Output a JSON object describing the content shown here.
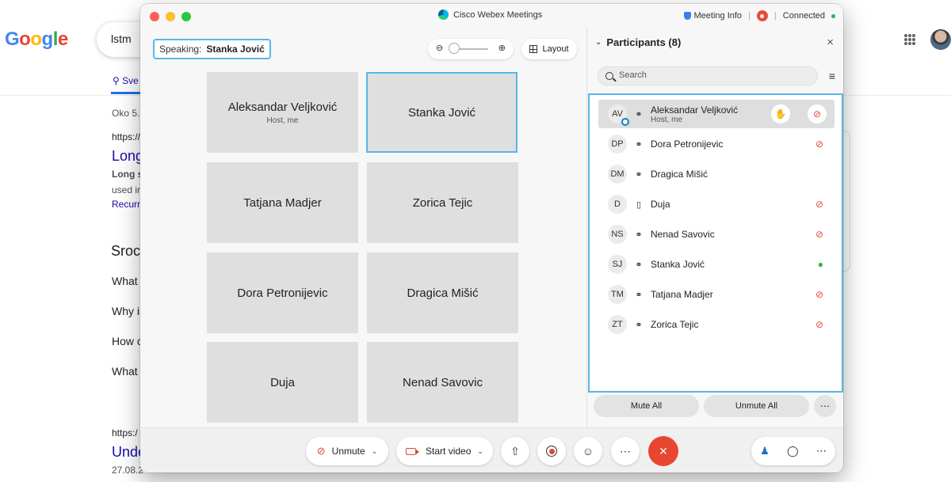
{
  "google": {
    "logo_letters": [
      "G",
      "o",
      "o",
      "g",
      "l",
      "e"
    ],
    "search_value": "lstm",
    "tab_label": "Sve",
    "stats": "Oko 5.",
    "result1_url": "https://",
    "result1_title": "Long",
    "result1_snippet1": "Long s",
    "result1_snippet2": "used ir",
    "result1_link": "Recurr",
    "section_heading": "Sroc",
    "questions": [
      "What",
      "Why is",
      "How c",
      "What"
    ],
    "result2_url": "https:/",
    "result2_title": "Unde",
    "result2_date": "27.08.2"
  },
  "window": {
    "title": "Cisco Webex Meetings",
    "meeting_info": "Meeting Info",
    "status": "Connected",
    "colors": {
      "close": "#fe5f57",
      "minimize": "#febc2e",
      "maximize": "#28c840",
      "accent": "#5bb5e8",
      "end_call": "#e8472f"
    }
  },
  "video": {
    "speaking_label": "Speaking:",
    "speaking_name": "Stanka Jović",
    "zoom_out_icon": "zoom-out-icon",
    "zoom_in_icon": "zoom-in-icon",
    "layout_label": "Layout",
    "tiles": [
      {
        "name": "Aleksandar Veljković",
        "sub": "Host, me"
      },
      {
        "name": "Stanka Jović",
        "sub": ""
      },
      {
        "name": "Tatjana Madjer",
        "sub": ""
      },
      {
        "name": "Zorica Tejic",
        "sub": ""
      },
      {
        "name": "Dora Petronijevic",
        "sub": ""
      },
      {
        "name": "Dragica Mišić",
        "sub": ""
      },
      {
        "name": "Duja",
        "sub": ""
      },
      {
        "name": "Nenad Savovic",
        "sub": ""
      }
    ]
  },
  "controls": {
    "unmute_label": "Unmute",
    "start_video_label": "Start video"
  },
  "participants": {
    "title": "Participants (8)",
    "search_placeholder": "Search",
    "mute_all": "Mute All",
    "unmute_all": "Unmute All",
    "list": [
      {
        "initials": "AV",
        "name": "Aleksandar Veljković",
        "sub": "Host, me",
        "device": "headset",
        "mic": "muted"
      },
      {
        "initials": "DP",
        "name": "Dora Petronijevic",
        "sub": "",
        "device": "headset",
        "mic": "muted"
      },
      {
        "initials": "DM",
        "name": "Dragica Mišić",
        "sub": "",
        "device": "headset",
        "mic": "none"
      },
      {
        "initials": "D",
        "name": "Duja",
        "sub": "",
        "device": "phone",
        "mic": "muted"
      },
      {
        "initials": "NS",
        "name": "Nenad Savovic",
        "sub": "",
        "device": "headset",
        "mic": "muted"
      },
      {
        "initials": "SJ",
        "name": "Stanka Jović",
        "sub": "",
        "device": "headset",
        "mic": "live"
      },
      {
        "initials": "TM",
        "name": "Tatjana Madjer",
        "sub": "",
        "device": "headset",
        "mic": "muted"
      },
      {
        "initials": "ZT",
        "name": "Zorica Tejic",
        "sub": "",
        "device": "headset",
        "mic": "muted"
      }
    ]
  }
}
